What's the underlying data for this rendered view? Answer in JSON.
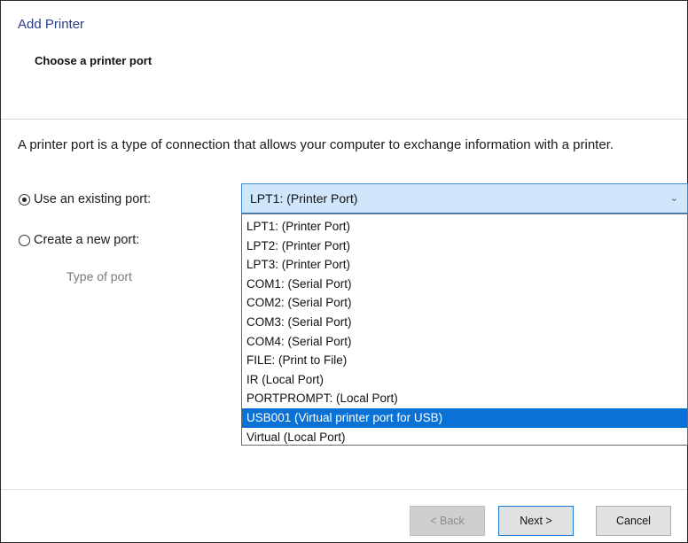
{
  "window": {
    "title": "Add Printer"
  },
  "header": {
    "heading": "Choose a printer port"
  },
  "description": "A printer port is a type of connection that allows your computer to exchange information with a printer.",
  "existing_port": {
    "label": "Use an existing port:",
    "selected": true,
    "dropdown_value": "LPT1: (Printer Port)",
    "options": [
      "LPT1: (Printer Port)",
      "LPT2: (Printer Port)",
      "LPT3: (Printer Port)",
      "COM1: (Serial Port)",
      "COM2: (Serial Port)",
      "COM3: (Serial Port)",
      "COM4: (Serial Port)",
      "FILE: (Print to File)",
      "IR (Local Port)",
      "PORTPROMPT: (Local Port)",
      "USB001 (Virtual printer port for USB)",
      "Virtual (Local Port)"
    ],
    "highlighted_option": "USB001 (Virtual printer port for USB)"
  },
  "new_port": {
    "label": "Create a new port:",
    "selected": false,
    "type_label": "Type of port"
  },
  "buttons": {
    "back": "< Back",
    "next": "Next >",
    "cancel": "Cancel"
  },
  "icons": {
    "dropdown_chevron": "chevron-down-icon"
  },
  "colors": {
    "title": "#2a3e87",
    "highlight": "#0a72d6",
    "select_bg": "#cfe6fb"
  }
}
